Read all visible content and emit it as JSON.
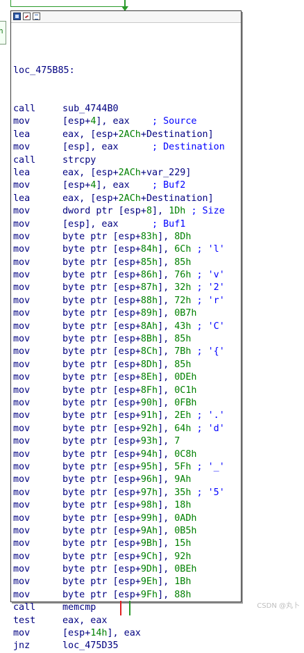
{
  "window": {
    "left_clip_text": "h",
    "title_icons": [
      "graph-node-icon",
      "edit-node-icon",
      "list-node-icon"
    ]
  },
  "block": {
    "label": "loc_475B85:",
    "lines": [
      {
        "mn": "call",
        "op": [
          [
            "sym",
            "sub_4744B0"
          ]
        ]
      },
      {
        "mn": "mov",
        "op": [
          [
            "op",
            "[esp+"
          ],
          [
            "num",
            "4"
          ],
          [
            "op",
            "], eax"
          ],
          [
            "sp",
            "    "
          ],
          [
            "cm",
            "; Source"
          ]
        ]
      },
      {
        "mn": "lea",
        "op": [
          [
            "op",
            "eax, [esp+"
          ],
          [
            "num",
            "2ACh"
          ],
          [
            "op",
            "+"
          ],
          [
            "sym",
            "Destination"
          ],
          [
            "op",
            "]"
          ]
        ]
      },
      {
        "mn": "mov",
        "op": [
          [
            "op",
            "[esp], eax"
          ],
          [
            "sp",
            "      "
          ],
          [
            "cm",
            "; Destination"
          ]
        ]
      },
      {
        "mn": "call",
        "op": [
          [
            "sym",
            "strcpy"
          ]
        ]
      },
      {
        "mn": "lea",
        "op": [
          [
            "op",
            "eax, [esp+"
          ],
          [
            "num",
            "2ACh"
          ],
          [
            "op",
            "+"
          ],
          [
            "sym",
            "var_229"
          ],
          [
            "op",
            "]"
          ]
        ]
      },
      {
        "mn": "mov",
        "op": [
          [
            "op",
            "[esp+"
          ],
          [
            "num",
            "4"
          ],
          [
            "op",
            "], eax"
          ],
          [
            "sp",
            "    "
          ],
          [
            "cm",
            "; Buf2"
          ]
        ]
      },
      {
        "mn": "lea",
        "op": [
          [
            "op",
            "eax, [esp+"
          ],
          [
            "num",
            "2ACh"
          ],
          [
            "op",
            "+"
          ],
          [
            "sym",
            "Destination"
          ],
          [
            "op",
            "]"
          ]
        ]
      },
      {
        "mn": "mov",
        "op": [
          [
            "op",
            "dword ptr [esp+"
          ],
          [
            "num",
            "8"
          ],
          [
            "op",
            "], "
          ],
          [
            "num",
            "1Dh"
          ],
          [
            "sp",
            " "
          ],
          [
            "cm",
            "; Size"
          ]
        ]
      },
      {
        "mn": "mov",
        "op": [
          [
            "op",
            "[esp], eax"
          ],
          [
            "sp",
            "      "
          ],
          [
            "cm",
            "; Buf1"
          ]
        ]
      },
      {
        "mn": "mov",
        "op": [
          [
            "op",
            "byte ptr [esp+"
          ],
          [
            "num",
            "83h"
          ],
          [
            "op",
            "], "
          ],
          [
            "num",
            "8Dh"
          ]
        ]
      },
      {
        "mn": "mov",
        "op": [
          [
            "op",
            "byte ptr [esp+"
          ],
          [
            "num",
            "84h"
          ],
          [
            "op",
            "], "
          ],
          [
            "num",
            "6Ch"
          ],
          [
            "sp",
            " "
          ],
          [
            "cm",
            "; 'l'"
          ]
        ]
      },
      {
        "mn": "mov",
        "op": [
          [
            "op",
            "byte ptr [esp+"
          ],
          [
            "num",
            "85h"
          ],
          [
            "op",
            "], "
          ],
          [
            "num",
            "85h"
          ]
        ]
      },
      {
        "mn": "mov",
        "op": [
          [
            "op",
            "byte ptr [esp+"
          ],
          [
            "num",
            "86h"
          ],
          [
            "op",
            "], "
          ],
          [
            "num",
            "76h"
          ],
          [
            "sp",
            " "
          ],
          [
            "cm",
            "; 'v'"
          ]
        ]
      },
      {
        "mn": "mov",
        "op": [
          [
            "op",
            "byte ptr [esp+"
          ],
          [
            "num",
            "87h"
          ],
          [
            "op",
            "], "
          ],
          [
            "num",
            "32h"
          ],
          [
            "sp",
            " "
          ],
          [
            "cm",
            "; '2'"
          ]
        ]
      },
      {
        "mn": "mov",
        "op": [
          [
            "op",
            "byte ptr [esp+"
          ],
          [
            "num",
            "88h"
          ],
          [
            "op",
            "], "
          ],
          [
            "num",
            "72h"
          ],
          [
            "sp",
            " "
          ],
          [
            "cm",
            "; 'r'"
          ]
        ]
      },
      {
        "mn": "mov",
        "op": [
          [
            "op",
            "byte ptr [esp+"
          ],
          [
            "num",
            "89h"
          ],
          [
            "op",
            "], "
          ],
          [
            "num",
            "0B7h"
          ]
        ]
      },
      {
        "mn": "mov",
        "op": [
          [
            "op",
            "byte ptr [esp+"
          ],
          [
            "num",
            "8Ah"
          ],
          [
            "op",
            "], "
          ],
          [
            "num",
            "43h"
          ],
          [
            "sp",
            " "
          ],
          [
            "cm",
            "; 'C'"
          ]
        ]
      },
      {
        "mn": "mov",
        "op": [
          [
            "op",
            "byte ptr [esp+"
          ],
          [
            "num",
            "8Bh"
          ],
          [
            "op",
            "], "
          ],
          [
            "num",
            "85h"
          ]
        ]
      },
      {
        "mn": "mov",
        "op": [
          [
            "op",
            "byte ptr [esp+"
          ],
          [
            "num",
            "8Ch"
          ],
          [
            "op",
            "], "
          ],
          [
            "num",
            "7Bh"
          ],
          [
            "sp",
            " "
          ],
          [
            "cm",
            "; '{'"
          ]
        ]
      },
      {
        "mn": "mov",
        "op": [
          [
            "op",
            "byte ptr [esp+"
          ],
          [
            "num",
            "8Dh"
          ],
          [
            "op",
            "], "
          ],
          [
            "num",
            "85h"
          ]
        ]
      },
      {
        "mn": "mov",
        "op": [
          [
            "op",
            "byte ptr [esp+"
          ],
          [
            "num",
            "8Eh"
          ],
          [
            "op",
            "], "
          ],
          [
            "num",
            "0DEh"
          ]
        ]
      },
      {
        "mn": "mov",
        "op": [
          [
            "op",
            "byte ptr [esp+"
          ],
          [
            "num",
            "8Fh"
          ],
          [
            "op",
            "], "
          ],
          [
            "num",
            "0C1h"
          ]
        ]
      },
      {
        "mn": "mov",
        "op": [
          [
            "op",
            "byte ptr [esp+"
          ],
          [
            "num",
            "90h"
          ],
          [
            "op",
            "], "
          ],
          [
            "num",
            "0FBh"
          ]
        ]
      },
      {
        "mn": "mov",
        "op": [
          [
            "op",
            "byte ptr [esp+"
          ],
          [
            "num",
            "91h"
          ],
          [
            "op",
            "], "
          ],
          [
            "num",
            "2Eh"
          ],
          [
            "sp",
            " "
          ],
          [
            "cm",
            "; '.'"
          ]
        ]
      },
      {
        "mn": "mov",
        "op": [
          [
            "op",
            "byte ptr [esp+"
          ],
          [
            "num",
            "92h"
          ],
          [
            "op",
            "], "
          ],
          [
            "num",
            "64h"
          ],
          [
            "sp",
            " "
          ],
          [
            "cm",
            "; 'd'"
          ]
        ]
      },
      {
        "mn": "mov",
        "op": [
          [
            "op",
            "byte ptr [esp+"
          ],
          [
            "num",
            "93h"
          ],
          [
            "op",
            "], "
          ],
          [
            "num",
            "7"
          ]
        ]
      },
      {
        "mn": "mov",
        "op": [
          [
            "op",
            "byte ptr [esp+"
          ],
          [
            "num",
            "94h"
          ],
          [
            "op",
            "], "
          ],
          [
            "num",
            "0C8h"
          ]
        ]
      },
      {
        "mn": "mov",
        "op": [
          [
            "op",
            "byte ptr [esp+"
          ],
          [
            "num",
            "95h"
          ],
          [
            "op",
            "], "
          ],
          [
            "num",
            "5Fh"
          ],
          [
            "sp",
            " "
          ],
          [
            "cm",
            "; '_'"
          ]
        ]
      },
      {
        "mn": "mov",
        "op": [
          [
            "op",
            "byte ptr [esp+"
          ],
          [
            "num",
            "96h"
          ],
          [
            "op",
            "], "
          ],
          [
            "num",
            "9Ah"
          ]
        ]
      },
      {
        "mn": "mov",
        "op": [
          [
            "op",
            "byte ptr [esp+"
          ],
          [
            "num",
            "97h"
          ],
          [
            "op",
            "], "
          ],
          [
            "num",
            "35h"
          ],
          [
            "sp",
            " "
          ],
          [
            "cm",
            "; '5'"
          ]
        ]
      },
      {
        "mn": "mov",
        "op": [
          [
            "op",
            "byte ptr [esp+"
          ],
          [
            "num",
            "98h"
          ],
          [
            "op",
            "], "
          ],
          [
            "num",
            "18h"
          ]
        ]
      },
      {
        "mn": "mov",
        "op": [
          [
            "op",
            "byte ptr [esp+"
          ],
          [
            "num",
            "99h"
          ],
          [
            "op",
            "], "
          ],
          [
            "num",
            "0ADh"
          ]
        ]
      },
      {
        "mn": "mov",
        "op": [
          [
            "op",
            "byte ptr [esp+"
          ],
          [
            "num",
            "9Ah"
          ],
          [
            "op",
            "], "
          ],
          [
            "num",
            "0B5h"
          ]
        ]
      },
      {
        "mn": "mov",
        "op": [
          [
            "op",
            "byte ptr [esp+"
          ],
          [
            "num",
            "9Bh"
          ],
          [
            "op",
            "], "
          ],
          [
            "num",
            "15h"
          ]
        ]
      },
      {
        "mn": "mov",
        "op": [
          [
            "op",
            "byte ptr [esp+"
          ],
          [
            "num",
            "9Ch"
          ],
          [
            "op",
            "], "
          ],
          [
            "num",
            "92h"
          ]
        ]
      },
      {
        "mn": "mov",
        "op": [
          [
            "op",
            "byte ptr [esp+"
          ],
          [
            "num",
            "9Dh"
          ],
          [
            "op",
            "], "
          ],
          [
            "num",
            "0BEh"
          ]
        ]
      },
      {
        "mn": "mov",
        "op": [
          [
            "op",
            "byte ptr [esp+"
          ],
          [
            "num",
            "9Eh"
          ],
          [
            "op",
            "], "
          ],
          [
            "num",
            "1Bh"
          ]
        ]
      },
      {
        "mn": "mov",
        "op": [
          [
            "op",
            "byte ptr [esp+"
          ],
          [
            "num",
            "9Fh"
          ],
          [
            "op",
            "], "
          ],
          [
            "num",
            "88h"
          ]
        ]
      },
      {
        "mn": "call",
        "op": [
          [
            "sym",
            "memcmp"
          ]
        ]
      },
      {
        "mn": "test",
        "op": [
          [
            "op",
            "eax, eax"
          ]
        ]
      },
      {
        "mn": "mov",
        "op": [
          [
            "op",
            "[esp+"
          ],
          [
            "num",
            "14h"
          ],
          [
            "op",
            "], eax"
          ]
        ]
      },
      {
        "mn": "jnz",
        "op": [
          [
            "sym",
            "loc_475D35"
          ]
        ]
      }
    ]
  },
  "watermark": "CSDN @丸卜",
  "colors": {
    "edge_green": "#2a9a2a",
    "edge_red": "#e02020",
    "mnemonic": "#000080",
    "number": "#008000",
    "comment": "#0000ff"
  }
}
